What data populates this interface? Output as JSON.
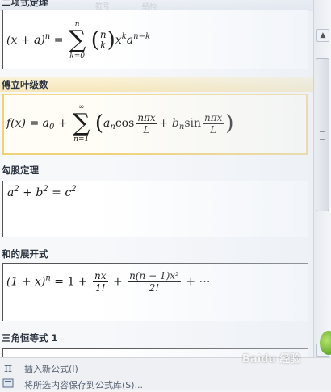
{
  "gallery": {
    "sections": [
      {
        "title": "二项式定理"
      },
      {
        "title": "傅立叶级数"
      },
      {
        "title": "勾股定理"
      },
      {
        "title": "和的展开式"
      },
      {
        "title": "三角恒等式 1"
      }
    ],
    "formulas": {
      "binomial": {
        "lhs": "(x + a)",
        "lhs_exp": "n",
        "eq": "=",
        "sum_top": "n",
        "sum_bottom": "k=0",
        "binom_top": "n",
        "binom_bottom": "k",
        "term": "x",
        "term_exp": "k",
        "term2": "a",
        "term2_exp": "n−k"
      },
      "fourier": {
        "lhs": "f(x) = a",
        "lhs_sub": "0",
        "plus": "+",
        "sum_top": "∞",
        "sum_bottom": "n=1",
        "a_n": "a",
        "n_sub": "n",
        "cos": "cos",
        "frac_num": "nπx",
        "frac_den": "L",
        "plus2": "+",
        "b_n": "b",
        "sin": "sin"
      },
      "pythagorean": {
        "a": "a",
        "b": "b",
        "c": "c",
        "exp": "2",
        "plus": "+",
        "eq": "="
      },
      "expansion": {
        "lhs": "(1 + x)",
        "lhs_exp": "n",
        "rhs_start": "= 1 +",
        "frac1_num": "nx",
        "frac1_den": "1!",
        "plus": "+",
        "frac2_num": "n(n − 1)x²",
        "frac2_den": "2!",
        "tail": "+ ⋯"
      }
    }
  },
  "footer": {
    "insert_label": "插入新公式(I)",
    "save_label": "将所选内容保存到公式库(S)...",
    "insert_icon": "pi-icon",
    "save_icon": "save-formula-icon"
  },
  "top_tabs": [
    "符号",
    "结构"
  ],
  "watermark": "Baidu 经验",
  "colors": {
    "highlight_bg": "#f6e7b9",
    "highlight_border": "#f0d27a",
    "text": "#2c3440"
  }
}
